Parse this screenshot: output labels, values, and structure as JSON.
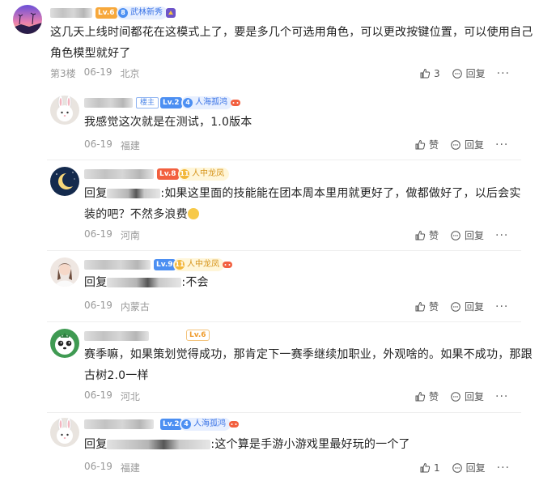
{
  "main_post": {
    "level": "Lv.6",
    "tag": "武林新秀",
    "text_line1": "这几天上线时间都花在这模式上了，要是多几个可选用角色，可以更改按键位置，可以使用自己",
    "text_line2": "角色模型就好了",
    "floor": "第3楼",
    "date": "06-19",
    "location": "北京",
    "like_count": "3",
    "reply_label": "回复",
    "more": "···"
  },
  "replies": [
    {
      "louzhu": "楼主",
      "level": "Lv.2",
      "tag": "人海孤鸿",
      "text_line1": "我感觉这次就是在测试，1.0版本",
      "date": "06-19",
      "location": "福建",
      "like_label": "赞",
      "reply_label": "回复",
      "more": "···"
    },
    {
      "level": "Lv.8",
      "tag": "人中龙凤",
      "reply_prefix": "回复",
      "text_line1": ":如果这里面的技能能在团本周本里用就更好了，做都做好了，以后会实",
      "text_line2": "装的吧？不然多浪费",
      "date": "06-19",
      "location": "河南",
      "like_label": "赞",
      "reply_label": "回复",
      "more": "···"
    },
    {
      "level": "Lv.9",
      "tag": "人中龙凤",
      "reply_prefix": "回复",
      "text_line1": ":不会",
      "date": "06-19",
      "location": "内蒙古",
      "like_label": "赞",
      "reply_label": "回复",
      "more": "···"
    },
    {
      "level": "Lv.6",
      "text_line1": "赛季嘛，如果策划觉得成功，那肯定下一赛季继续加职业，外观啥的。如果不成功，那跟",
      "text_line2": "古树2.0一样",
      "date": "06-19",
      "location": "河北",
      "like_label": "赞",
      "reply_label": "回复",
      "more": "···"
    },
    {
      "level": "Lv.2",
      "tag": "人海孤鸿",
      "reply_prefix": "回复",
      "text_line1": ":这个算是手游小游戏里最好玩的一个了",
      "date": "06-19",
      "location": "福建",
      "like_count": "1",
      "reply_label": "回复",
      "more": "···"
    }
  ],
  "colors": {
    "level_orange": "#f7a83b",
    "level_blue": "#4c8ff2",
    "level_red": "#f2603f",
    "meta_gray": "#999999"
  }
}
